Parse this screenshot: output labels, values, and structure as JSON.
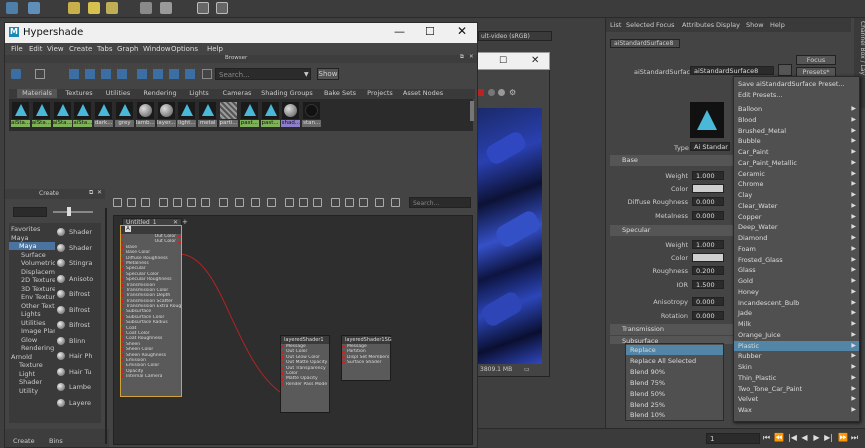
{
  "hypershade": {
    "title": "Hypershade",
    "menu": [
      "File",
      "Edit",
      "View",
      "Create",
      "Tabs",
      "Graph",
      "Window",
      "Options",
      "Help"
    ],
    "browser_label": "Browser",
    "search_placeholder": "Search...",
    "show_label": "Show",
    "browser_tabs": [
      "Materials",
      "Textures",
      "Utilities",
      "Rendering",
      "Lights",
      "Cameras",
      "Shading Groups",
      "Bake Sets",
      "Projects",
      "Asset Nodes"
    ],
    "swatches": [
      "aiSta...",
      "aiSta...",
      "aiSta...",
      "aiSta...",
      "dark...",
      "grey",
      "lamb...",
      "layer...",
      "light...",
      "metal",
      "parti...",
      "past...",
      "past...",
      "shad...",
      "stan..."
    ],
    "create_label": "Create",
    "tree": [
      "Favorites",
      "Maya",
      "Maya",
      "Surface",
      "Volumetric",
      "Displacem",
      "2D Texture",
      "3D Texture",
      "Env Textur",
      "Other Text",
      "Lights",
      "Utilities",
      "Image Plan",
      "Glow",
      "Rendering",
      "Arnold",
      "Texture",
      "Light",
      "Shader",
      "Utility"
    ],
    "create_list": [
      "Shader",
      "Shader",
      "Stingra",
      "Anisoto",
      "Bifrost",
      "Bifrost",
      "Bifrost",
      "Blinn",
      "Hair Ph",
      "Hair Tu",
      "Lambe",
      "Layere"
    ],
    "bottom_tabs": [
      "Create",
      "Bins"
    ],
    "graph_tab": "Untitled_1",
    "graph_search_placeholder": "Search...",
    "node1": {
      "ports": [
        "Base",
        "Base Color",
        "Diffuse Roughness",
        "Metalness",
        "Specular",
        "Specular Color",
        "Specular Roughness",
        "Transmission",
        "Transmission Color",
        "Transmission Depth",
        "Transmission Scatter",
        "Transmission Extra Roughness",
        "Subsurface",
        "Subsurface Color",
        "Subsurface Radius",
        "Coat",
        "Coat Color",
        "Coat Roughness",
        "Sheen",
        "Sheen Color",
        "Sheen Roughness",
        "Emission",
        "Emission Color",
        "Opacity",
        "Internal Camera"
      ],
      "outs": [
        "Out Color",
        "Out Color"
      ]
    },
    "node2": {
      "title": "layeredShader1",
      "ports": [
        "Message",
        "Out Color",
        "Out Glow Color",
        "Out Matte Opacity",
        "Out Transparency",
        "Color",
        "Matte Opacity",
        "Render Pass Mode"
      ]
    },
    "node3": {
      "title": "layeredShader1SG",
      "ports": [
        "Message",
        "Partition",
        "Displ Set Members",
        "Surface Shader"
      ]
    }
  },
  "render_view": {
    "color_space": "ult-video (sRGB)",
    "status": "3809.1 MB"
  },
  "ae": {
    "tabs": [
      "List",
      "Selected",
      "Focus",
      "Attributes",
      "Display",
      "Show",
      "Help"
    ],
    "node_tab": "aiStandardSurface8",
    "node_label": "aiStandardSurface:",
    "node_value": "aiStandardSurface8",
    "focus_label": "Focus",
    "presets_label": "Presets*",
    "type_label": "Type",
    "type_value": "Ai Standar",
    "sections": [
      "Base",
      "Specular",
      "Transmission",
      "Subsurface"
    ],
    "attrs": [
      [
        "Weight",
        "1.000"
      ],
      [
        "Color",
        ""
      ],
      [
        "Diffuse Roughness",
        "0.000"
      ],
      [
        "Metalness",
        "0.000"
      ],
      [
        "Weight",
        "1.000"
      ],
      [
        "Color",
        ""
      ],
      [
        "Roughness",
        "0.200"
      ],
      [
        "IOR",
        "1.500"
      ],
      [
        "Anisotropy",
        "0.000"
      ],
      [
        "Rotation",
        "0.000"
      ]
    ],
    "side_label": "Channel Box / Lay"
  },
  "preset_menu": {
    "items": [
      "Save aiStandardSurface Preset...",
      "Edit Presets...",
      "Balloon",
      "Blood",
      "Brushed_Metal",
      "Bubble",
      "Car_Paint",
      "Car_Paint_Metallic",
      "Ceramic",
      "Chrome",
      "Clay",
      "Clear_Water",
      "Copper",
      "Deep_Water",
      "Diamond",
      "Foam",
      "Frosted_Glass",
      "Glass",
      "Gold",
      "Honey",
      "Incandescent_Bulb",
      "Jade",
      "Milk",
      "Orange_Juice",
      "Plastic",
      "Rubber",
      "Skin",
      "Thin_Plastic",
      "Two_Tone_Car_Paint",
      "Velvet",
      "Wax"
    ],
    "highlight": "Plastic"
  },
  "submenu": {
    "items": [
      "Replace",
      "Replace All Selected",
      "Blend 90%",
      "Blend 75%",
      "Blend 50%",
      "Blend 25%",
      "Blend 10%"
    ],
    "highlight": "Replace"
  },
  "timeline": {
    "frame": "1"
  },
  "colors": {
    "highlight": "#5285a6",
    "select": "#4a73a0",
    "swatch_green": "#7fb05a",
    "swatch_purple": "#8c7ec8"
  }
}
